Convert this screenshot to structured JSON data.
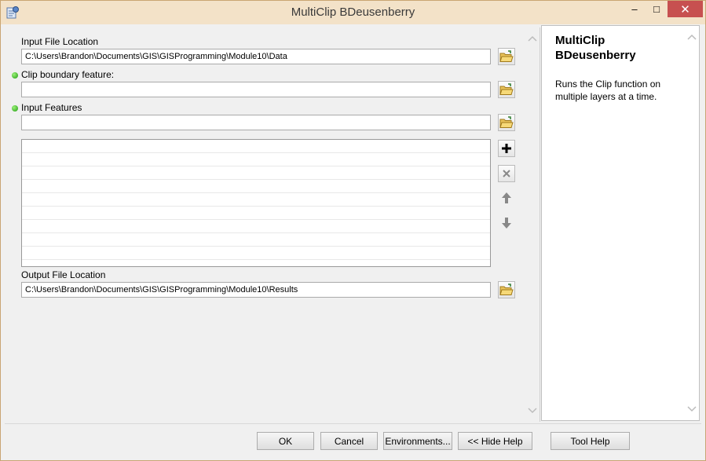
{
  "window": {
    "title": "MultiClip BDeusenberry",
    "minimize_glyph": "–",
    "maximize_glyph": "□",
    "close_glyph": "✕"
  },
  "form": {
    "input_location": {
      "label": "Input File Location",
      "value": "C:\\Users\\Brandon\\Documents\\GIS\\GISProgramming\\Module10\\Data",
      "required": false
    },
    "clip_boundary": {
      "label": "Clip boundary feature:",
      "value": "",
      "required": true
    },
    "input_features": {
      "label": "Input Features",
      "value": "",
      "required": true,
      "list_items": []
    },
    "output_location": {
      "label": "Output File Location",
      "value": "C:\\Users\\Brandon\\Documents\\GIS\\GISProgramming\\Module10\\Results",
      "required": false
    }
  },
  "help": {
    "title": "MultiClip BDeusenberry",
    "description": "Runs the Clip function on multiple layers at a time."
  },
  "buttons": {
    "ok": "OK",
    "cancel": "Cancel",
    "environments": "Environments...",
    "hide_help": "<< Hide Help",
    "tool_help": "Tool Help"
  },
  "icons": {
    "app": "toolbox-script-icon",
    "browse": "open-folder-icon",
    "add": "plus-icon",
    "remove": "x-icon",
    "up": "arrow-up-icon",
    "down": "arrow-down-icon"
  },
  "colors": {
    "title_bar": "#f3e2c8",
    "close_button": "#c75050",
    "required_dot": "#1f9b10"
  }
}
